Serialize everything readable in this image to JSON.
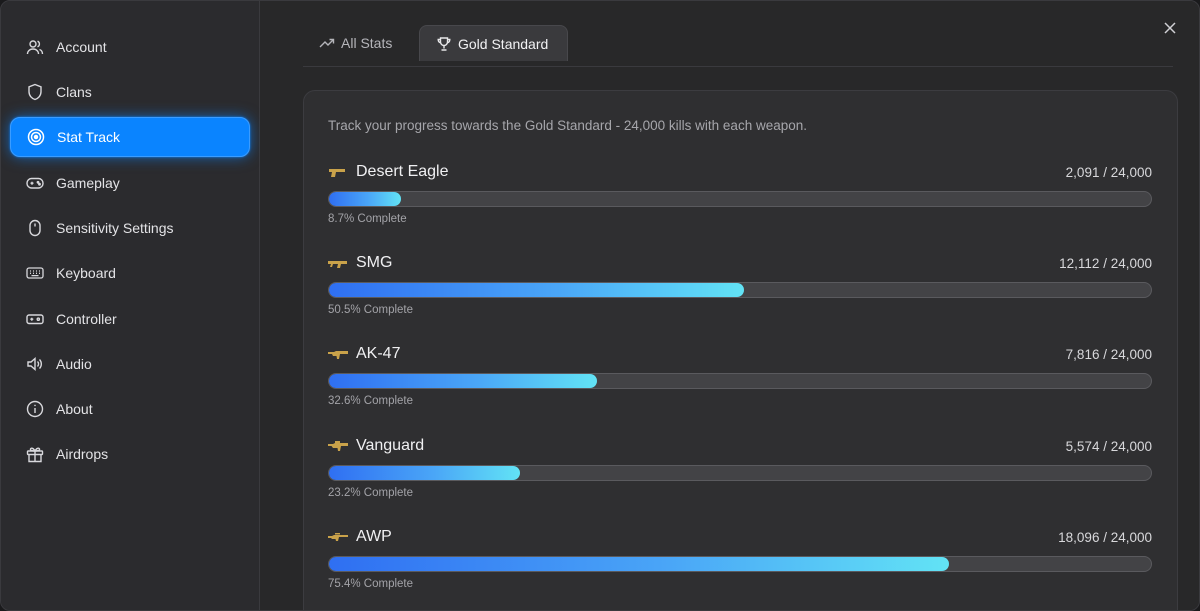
{
  "sidebar": {
    "items": [
      {
        "label": "Account",
        "icon": "user-icon",
        "active": false
      },
      {
        "label": "Clans",
        "icon": "shield-icon",
        "active": false
      },
      {
        "label": "Stat Track",
        "icon": "target-icon",
        "active": true
      },
      {
        "label": "Gameplay",
        "icon": "gamepad-icon",
        "active": false
      },
      {
        "label": "Sensitivity Settings",
        "icon": "mouse-icon",
        "active": false
      },
      {
        "label": "Keyboard",
        "icon": "keyboard-icon",
        "active": false
      },
      {
        "label": "Controller",
        "icon": "controller-icon",
        "active": false
      },
      {
        "label": "Audio",
        "icon": "speaker-icon",
        "active": false
      },
      {
        "label": "About",
        "icon": "info-icon",
        "active": false
      },
      {
        "label": "Airdrops",
        "icon": "gift-icon",
        "active": false
      }
    ]
  },
  "tabs": [
    {
      "label": "All Stats",
      "icon": "trend-up-icon",
      "active": false
    },
    {
      "label": "Gold Standard",
      "icon": "trophy-icon",
      "active": true
    }
  ],
  "gold_standard": {
    "intro": "Track your progress towards the Gold Standard - 24,000 kills with each weapon.",
    "weapons": [
      {
        "name": "Desert Eagle",
        "count": "2,091 / 24,000",
        "percent_label": "8.7% Complete",
        "progress": 0.087
      },
      {
        "name": "SMG",
        "count": "12,112 / 24,000",
        "percent_label": "50.5% Complete",
        "progress": 0.505
      },
      {
        "name": "AK-47",
        "count": "7,816 / 24,000",
        "percent_label": "32.6% Complete",
        "progress": 0.326
      },
      {
        "name": "Vanguard",
        "count": "5,574 / 24,000",
        "percent_label": "23.2% Complete",
        "progress": 0.232
      },
      {
        "name": "AWP",
        "count": "18,096 / 24,000",
        "percent_label": "75.4% Complete",
        "progress": 0.754
      }
    ]
  },
  "colors": {
    "accent": "#0a84ff",
    "progress_start": "#2f6ff2",
    "progress_end": "#62e3f5"
  }
}
